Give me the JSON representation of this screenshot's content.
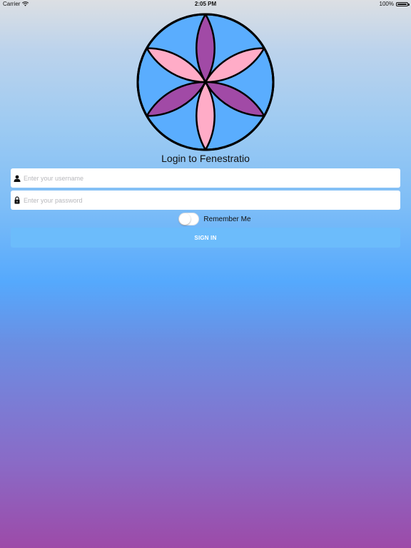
{
  "status_bar": {
    "carrier": "Carrier",
    "time": "2:05 PM",
    "battery": "100%"
  },
  "login": {
    "title": "Login to Fenestratio",
    "username_placeholder": "Enter your username",
    "password_placeholder": "Enter your password",
    "remember_label": "Remember Me",
    "remember_on": false,
    "signin_label": "SIGN IN"
  },
  "colors": {
    "logo_circle": "#5aadfe",
    "petal_purple": "#a14aa6",
    "petal_pink": "#ffacc7",
    "signin_button": "#6cbcfb",
    "gradient_top": "#dcdfe3",
    "gradient_mid": "#55a9fd",
    "gradient_bottom": "#9d4aa8"
  },
  "icons": {
    "wifi": "wifi-icon",
    "battery": "battery-icon",
    "user": "user-icon",
    "lock": "lock-icon",
    "logo": "flower-of-life-logo"
  }
}
